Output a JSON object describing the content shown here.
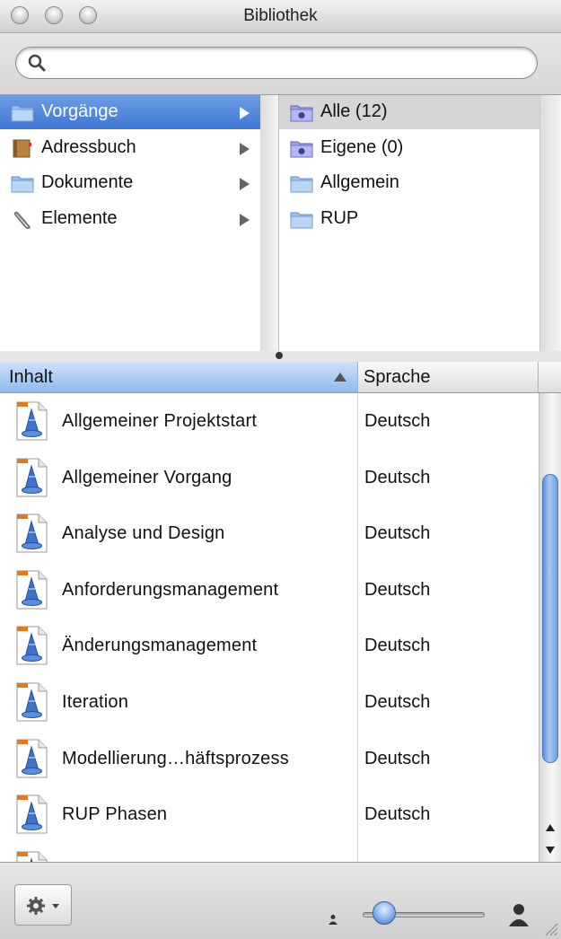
{
  "window": {
    "title": "Bibliothek"
  },
  "search": {
    "value": "",
    "placeholder": ""
  },
  "browser": {
    "left_column": [
      {
        "label": "Vorgänge",
        "icon": "folder-icon",
        "selected": true
      },
      {
        "label": "Adressbuch",
        "icon": "address-book-icon",
        "selected": false
      },
      {
        "label": "Dokumente",
        "icon": "folder-icon",
        "selected": false
      },
      {
        "label": "Elemente",
        "icon": "paperclip-icon",
        "selected": false
      }
    ],
    "right_column": [
      {
        "label": "Alle (12)",
        "icon": "smart-folder-icon",
        "selected": true
      },
      {
        "label": "Eigene (0)",
        "icon": "smart-folder-icon",
        "selected": false
      },
      {
        "label": "Allgemein",
        "icon": "folder-icon",
        "selected": false
      },
      {
        "label": "RUP",
        "icon": "folder-icon",
        "selected": false
      }
    ]
  },
  "table": {
    "columns": {
      "content": "Inhalt",
      "language": "Sprache"
    },
    "rows": [
      {
        "name": "Allgemeiner Projektstart",
        "language": "Deutsch"
      },
      {
        "name": "Allgemeiner Vorgang",
        "language": "Deutsch"
      },
      {
        "name": "Analyse und Design",
        "language": "Deutsch"
      },
      {
        "name": "Anforderungsmanagement",
        "language": "Deutsch"
      },
      {
        "name": "Änderungsmanagement",
        "language": "Deutsch"
      },
      {
        "name": "Iteration",
        "language": "Deutsch"
      },
      {
        "name": "Modellierung…häftsprozess",
        "language": "Deutsch"
      },
      {
        "name": "RUP Phasen",
        "language": "Deutsch"
      },
      {
        "name": "",
        "language": ""
      }
    ]
  },
  "colors": {
    "selection_blue": "#3d77d5",
    "header_blue": "#8fb8ee",
    "scroll_thumb": "#5d8fd8"
  },
  "icons": {
    "row_document": "wizard-document-icon",
    "action": "gear-icon",
    "zoom_small": "person-small-icon",
    "zoom_large": "person-large-icon"
  },
  "zoom": {
    "level": 0.1
  }
}
